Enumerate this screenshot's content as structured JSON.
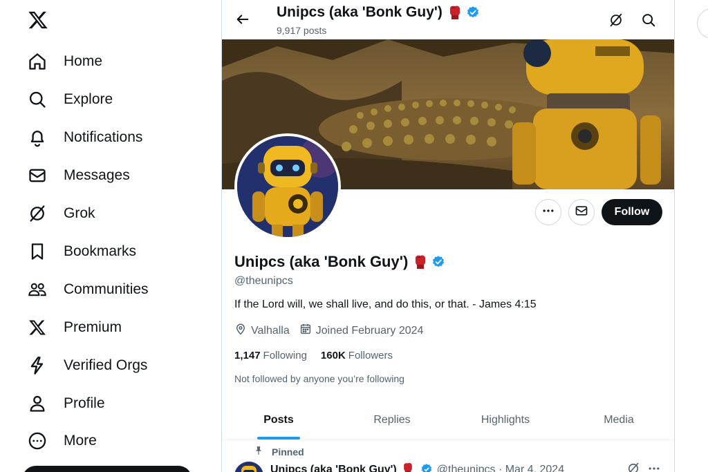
{
  "nav": {
    "items": [
      {
        "label": "Home",
        "icon": "home-icon"
      },
      {
        "label": "Explore",
        "icon": "search-icon"
      },
      {
        "label": "Notifications",
        "icon": "bell-icon"
      },
      {
        "label": "Messages",
        "icon": "envelope-icon"
      },
      {
        "label": "Grok",
        "icon": "grok-icon"
      },
      {
        "label": "Bookmarks",
        "icon": "bookmark-icon"
      },
      {
        "label": "Communities",
        "icon": "communities-icon"
      },
      {
        "label": "Premium",
        "icon": "x-logo-icon"
      },
      {
        "label": "Verified Orgs",
        "icon": "lightning-icon"
      },
      {
        "label": "Profile",
        "icon": "person-icon"
      },
      {
        "label": "More",
        "icon": "more-circle-icon"
      }
    ]
  },
  "header": {
    "name": "Unipcs (aka 'Bonk Guy')",
    "post_count": "9,917 posts"
  },
  "profile": {
    "name": "Unipcs (aka 'Bonk Guy')",
    "handle": "@theunipcs",
    "bio": "If the Lord will, we shall live, and do this, or that. - James 4:15",
    "location": "Valhalla",
    "joined": "Joined February 2024",
    "following_count": "1,147",
    "following_label": "Following",
    "followers_count": "160K",
    "followers_label": "Followers",
    "not_followed": "Not followed by anyone you’re following",
    "follow_button": "Follow"
  },
  "tabs": [
    {
      "label": "Posts",
      "active": true
    },
    {
      "label": "Replies",
      "active": false
    },
    {
      "label": "Highlights",
      "active": false
    },
    {
      "label": "Media",
      "active": false
    }
  ],
  "pinned_post": {
    "pinned_label": "Pinned",
    "author": "Unipcs (aka 'Bonk Guy')",
    "meta": "@theunipcs · Mar 4, 2024"
  },
  "colors": {
    "accent": "#1d9bf0",
    "text": "#0f1419",
    "muted": "#536471",
    "verified": "#1d9bf0"
  }
}
